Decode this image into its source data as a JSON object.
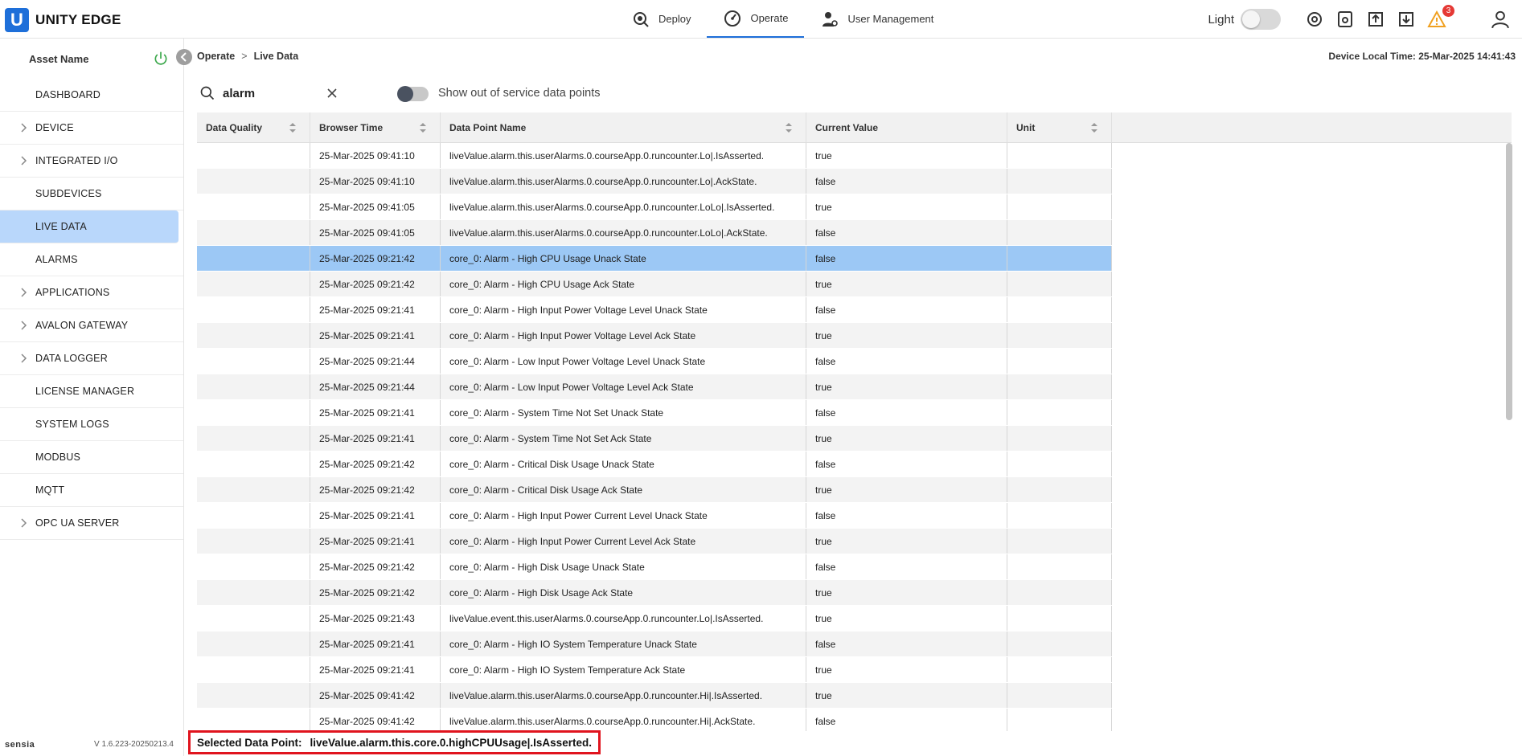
{
  "app": {
    "logo_letter": "U",
    "title": "UNITY EDGE"
  },
  "nav": [
    {
      "label": "Deploy",
      "icon": "deploy-gear-icon"
    },
    {
      "label": "Operate",
      "icon": "gauge-icon",
      "active": true
    },
    {
      "label": "User Management",
      "icon": "user-gear-icon"
    }
  ],
  "tools": {
    "theme_label": "Light",
    "alert_count": "3"
  },
  "sidebar": {
    "asset_name": "Asset Name",
    "items": [
      {
        "label": "DASHBOARD",
        "expandable": false
      },
      {
        "label": "DEVICE",
        "expandable": true
      },
      {
        "label": "INTEGRATED I/O",
        "expandable": true
      },
      {
        "label": "SUBDEVICES",
        "expandable": false
      },
      {
        "label": "LIVE DATA",
        "expandable": false,
        "active": true
      },
      {
        "label": "ALARMS",
        "expandable": false
      },
      {
        "label": "APPLICATIONS",
        "expandable": true
      },
      {
        "label": "AVALON GATEWAY",
        "expandable": true
      },
      {
        "label": "DATA LOGGER",
        "expandable": true
      },
      {
        "label": "LICENSE MANAGER",
        "expandable": false
      },
      {
        "label": "SYSTEM LOGS",
        "expandable": false
      },
      {
        "label": "MODBUS",
        "expandable": false
      },
      {
        "label": "MQTT",
        "expandable": false
      },
      {
        "label": "OPC UA SERVER",
        "expandable": true
      }
    ],
    "brand": "sensia",
    "version": "V 1.6.223-20250213.4"
  },
  "breadcrumb": {
    "parent": "Operate",
    "sep": ">",
    "current": "Live Data"
  },
  "device_time": "Device Local Time: 25-Mar-2025 14:41:43",
  "search": {
    "value": "alarm"
  },
  "out_of_service_label": "Show out of service data points",
  "table": {
    "headers": [
      "Data Quality",
      "Browser Time",
      "Data Point Name",
      "Current Value",
      "Unit"
    ],
    "rows": [
      {
        "quality": "",
        "time": "25-Mar-2025 09:41:10",
        "name": "liveValue.alarm.this.userAlarms.0.courseApp.0.runcounter.Lo|.IsAsserted.",
        "value": "true",
        "unit": ""
      },
      {
        "quality": "",
        "time": "25-Mar-2025 09:41:10",
        "name": "liveValue.alarm.this.userAlarms.0.courseApp.0.runcounter.Lo|.AckState.",
        "value": "false",
        "unit": ""
      },
      {
        "quality": "",
        "time": "25-Mar-2025 09:41:05",
        "name": "liveValue.alarm.this.userAlarms.0.courseApp.0.runcounter.LoLo|.IsAsserted.",
        "value": "true",
        "unit": ""
      },
      {
        "quality": "",
        "time": "25-Mar-2025 09:41:05",
        "name": "liveValue.alarm.this.userAlarms.0.courseApp.0.runcounter.LoLo|.AckState.",
        "value": "false",
        "unit": ""
      },
      {
        "quality": "",
        "time": "25-Mar-2025 09:21:42",
        "name": "core_0: Alarm - High CPU Usage Unack State",
        "value": "false",
        "unit": "",
        "selected": true
      },
      {
        "quality": "",
        "time": "25-Mar-2025 09:21:42",
        "name": "core_0: Alarm - High CPU Usage Ack State",
        "value": "true",
        "unit": ""
      },
      {
        "quality": "",
        "time": "25-Mar-2025 09:21:41",
        "name": "core_0: Alarm - High Input Power Voltage Level Unack State",
        "value": "false",
        "unit": ""
      },
      {
        "quality": "",
        "time": "25-Mar-2025 09:21:41",
        "name": "core_0: Alarm - High Input Power Voltage Level Ack State",
        "value": "true",
        "unit": ""
      },
      {
        "quality": "",
        "time": "25-Mar-2025 09:21:44",
        "name": "core_0: Alarm - Low Input Power Voltage Level Unack State",
        "value": "false",
        "unit": ""
      },
      {
        "quality": "",
        "time": "25-Mar-2025 09:21:44",
        "name": "core_0: Alarm - Low Input Power Voltage Level Ack State",
        "value": "true",
        "unit": ""
      },
      {
        "quality": "",
        "time": "25-Mar-2025 09:21:41",
        "name": "core_0: Alarm - System Time Not Set Unack State",
        "value": "false",
        "unit": ""
      },
      {
        "quality": "",
        "time": "25-Mar-2025 09:21:41",
        "name": "core_0: Alarm - System Time Not Set Ack State",
        "value": "true",
        "unit": ""
      },
      {
        "quality": "",
        "time": "25-Mar-2025 09:21:42",
        "name": "core_0: Alarm - Critical Disk Usage Unack State",
        "value": "false",
        "unit": ""
      },
      {
        "quality": "",
        "time": "25-Mar-2025 09:21:42",
        "name": "core_0: Alarm - Critical Disk Usage Ack State",
        "value": "true",
        "unit": ""
      },
      {
        "quality": "",
        "time": "25-Mar-2025 09:21:41",
        "name": "core_0: Alarm - High Input Power Current Level Unack State",
        "value": "false",
        "unit": ""
      },
      {
        "quality": "",
        "time": "25-Mar-2025 09:21:41",
        "name": "core_0: Alarm - High Input Power Current Level Ack State",
        "value": "true",
        "unit": ""
      },
      {
        "quality": "",
        "time": "25-Mar-2025 09:21:42",
        "name": "core_0: Alarm - High Disk Usage Unack State",
        "value": "false",
        "unit": ""
      },
      {
        "quality": "",
        "time": "25-Mar-2025 09:21:42",
        "name": "core_0: Alarm - High Disk Usage Ack State",
        "value": "true",
        "unit": ""
      },
      {
        "quality": "",
        "time": "25-Mar-2025 09:21:43",
        "name": "liveValue.event.this.userAlarms.0.courseApp.0.runcounter.Lo|.IsAsserted.",
        "value": "true",
        "unit": ""
      },
      {
        "quality": "",
        "time": "25-Mar-2025 09:21:41",
        "name": "core_0: Alarm - High IO System Temperature Unack State",
        "value": "false",
        "unit": ""
      },
      {
        "quality": "",
        "time": "25-Mar-2025 09:21:41",
        "name": "core_0: Alarm - High IO System Temperature Ack State",
        "value": "true",
        "unit": ""
      },
      {
        "quality": "",
        "time": "25-Mar-2025 09:41:42",
        "name": "liveValue.alarm.this.userAlarms.0.courseApp.0.runcounter.Hi|.IsAsserted.",
        "value": "true",
        "unit": ""
      },
      {
        "quality": "",
        "time": "25-Mar-2025 09:41:42",
        "name": "liveValue.alarm.this.userAlarms.0.courseApp.0.runcounter.Hi|.AckState.",
        "value": "false",
        "unit": ""
      }
    ]
  },
  "selected_point": {
    "label": "Selected Data Point:",
    "value": "liveValue.alarm.this.core.0.highCPUUsage|.IsAsserted."
  },
  "colors": {
    "accent": "#1e6fd9",
    "selected_row": "#9cc8f5",
    "sidebar_active": "#b9d7fb",
    "highlight_border": "#e0141e",
    "badge": "#e53935"
  }
}
